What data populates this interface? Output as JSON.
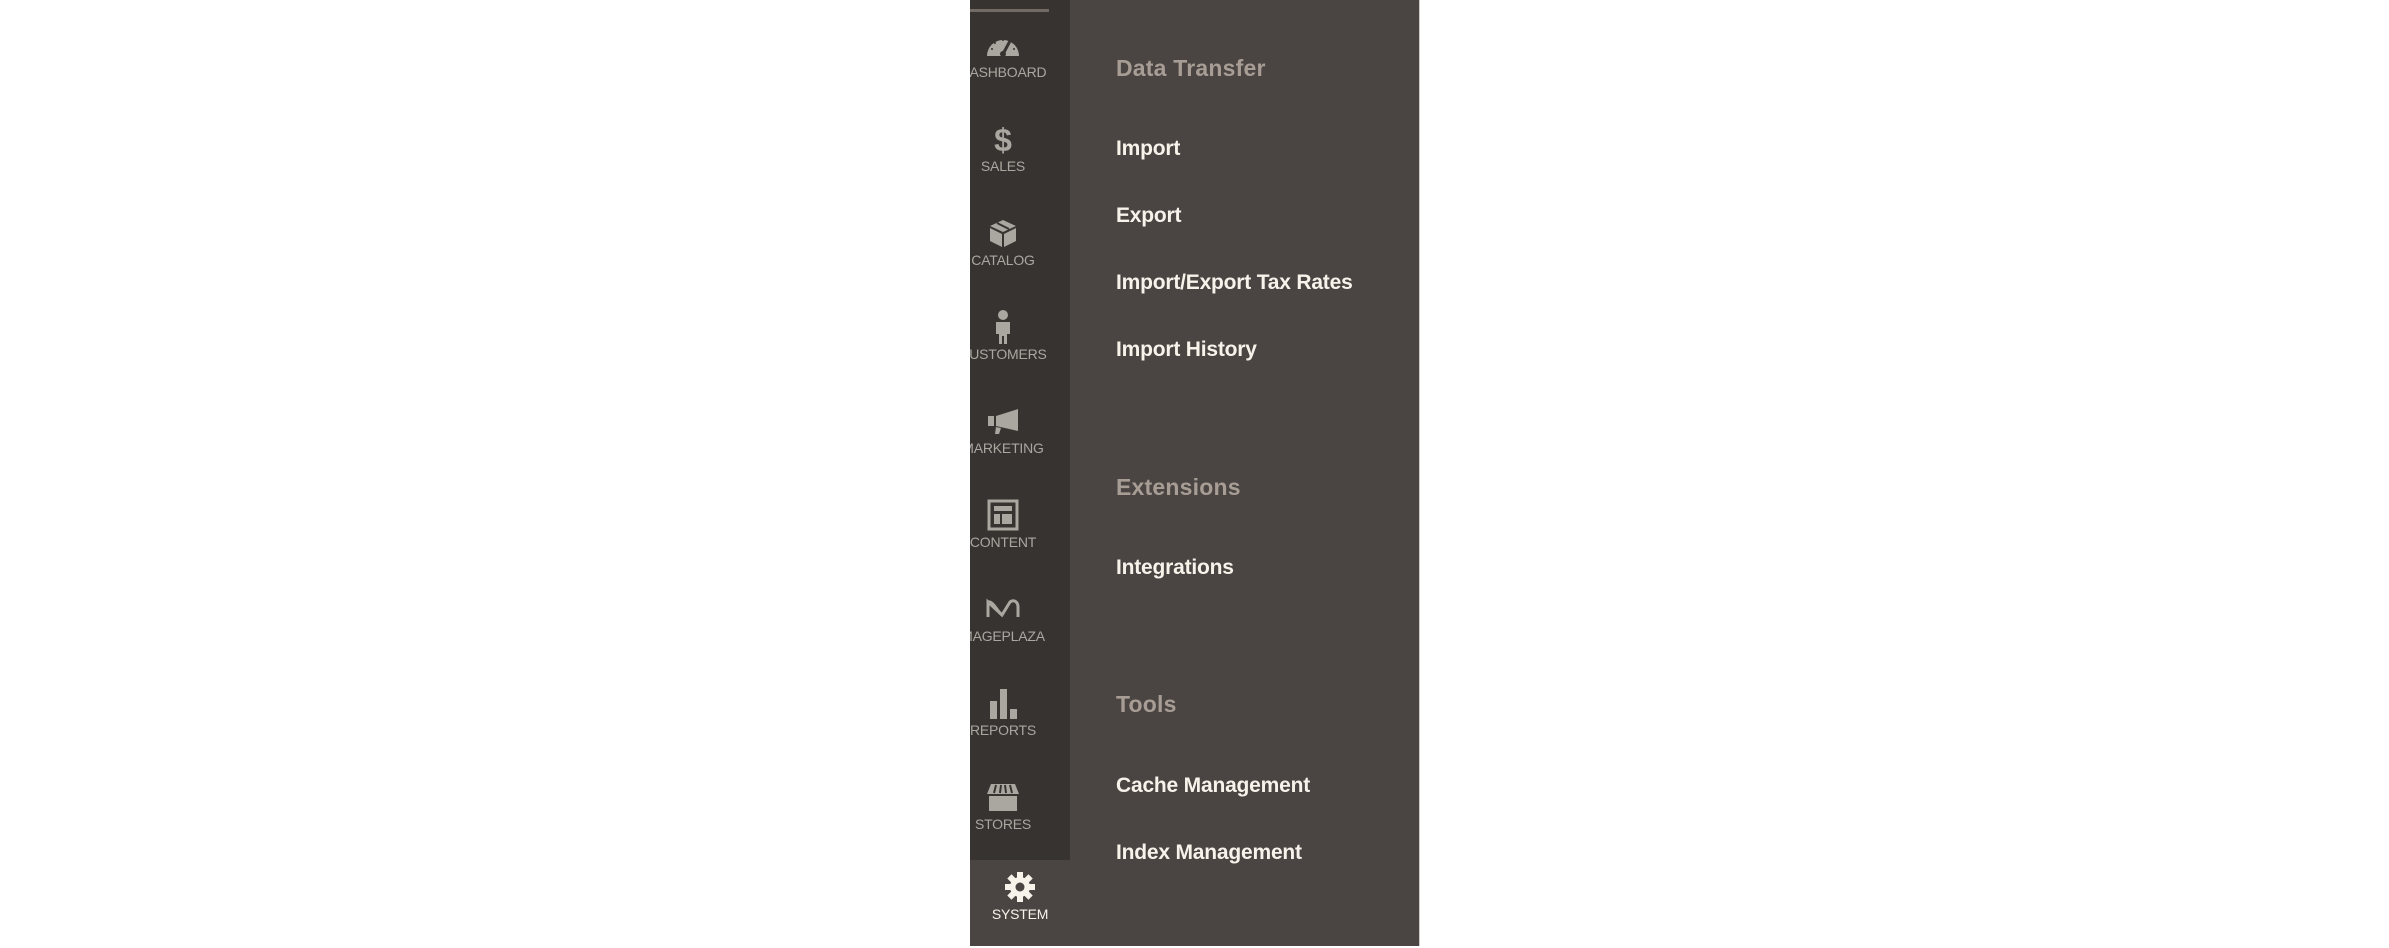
{
  "sidebar": {
    "items": [
      {
        "label": "DASHBOARD",
        "icon": "dashboard-gauge-icon"
      },
      {
        "label": "SALES",
        "icon": "dollar-icon"
      },
      {
        "label": "CATALOG",
        "icon": "box-icon"
      },
      {
        "label": "CUSTOMERS",
        "icon": "person-icon"
      },
      {
        "label": "MARKETING",
        "icon": "megaphone-icon"
      },
      {
        "label": "CONTENT",
        "icon": "layout-icon"
      },
      {
        "label": "MAGEPLAZA",
        "icon": "mageplaza-logo-icon"
      },
      {
        "label": "REPORTS",
        "icon": "bar-chart-icon"
      },
      {
        "label": "STORES",
        "icon": "storefront-icon"
      },
      {
        "label": "SYSTEM",
        "icon": "gear-icon",
        "active": true
      }
    ]
  },
  "menu": {
    "sections": [
      {
        "title": "Data Transfer",
        "items": [
          "Import",
          "Export",
          "Import/Export Tax Rates",
          "Import History"
        ]
      },
      {
        "title": "Extensions",
        "items": [
          "Integrations"
        ]
      },
      {
        "title": "Tools",
        "items": [
          "Cache Management",
          "Index Management"
        ]
      }
    ]
  },
  "colors": {
    "sidebar_bg": "#373330",
    "panel_bg": "#4a4542",
    "heading": "#a79d95",
    "link": "#f7f3eb",
    "icon": "#aaa6a0"
  }
}
